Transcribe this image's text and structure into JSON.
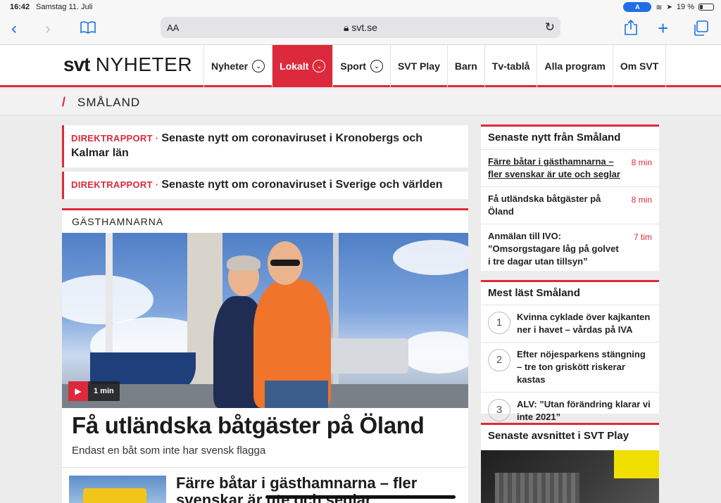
{
  "status_bar": {
    "time": "16:42",
    "date": "Samstag 11. Juli",
    "pill": "A",
    "battery": "19 %"
  },
  "browser": {
    "text_size": "AA",
    "domain": "svt.se"
  },
  "header": {
    "logo_bold": "svt",
    "logo_rest": "NYHETER",
    "nav": [
      {
        "label": "Nyheter",
        "dropdown": true
      },
      {
        "label": "Lokalt",
        "dropdown": true,
        "active": true
      },
      {
        "label": "Sport",
        "dropdown": true
      },
      {
        "label": "SVT Play"
      },
      {
        "label": "Barn"
      },
      {
        "label": "Tv-tablå"
      },
      {
        "label": "Alla program"
      },
      {
        "label": "Om SVT"
      }
    ]
  },
  "region": {
    "name": "SMÅLAND"
  },
  "direktrapport": [
    {
      "tag": "DIREKTRAPPORT",
      "sep": " · ",
      "text": "Senaste nytt om coronaviruset i Kronobergs och Kalmar län"
    },
    {
      "tag": "DIREKTRAPPORT",
      "sep": " · ",
      "text": "Senaste nytt om coronaviruset i Sverige och världen"
    }
  ],
  "feature": {
    "kicker": "GÄSTHAMNARNA",
    "video_duration": "1 min",
    "headline": "Få utländska båtgäster på Öland",
    "lead": "Endast en båt som inte har svensk flagga",
    "sub_headline": "Färre båtar i gästhamnarna – fler svenskar är ute och seglar"
  },
  "sidebar": {
    "latest": {
      "title": "Senaste nytt från Småland",
      "items": [
        {
          "text": "Färre båtar i gästhamnarna – fler svenskar är ute och seglar",
          "ago": "8 min"
        },
        {
          "text": "Få utländska båtgäster på Öland",
          "ago": "8 min"
        },
        {
          "text": "Anmälan till IVO: ”Omsorgstagare låg på golvet i tre dagar utan tillsyn”",
          "ago": "7 tim"
        }
      ]
    },
    "most_read": {
      "title": "Mest läst Småland",
      "items": [
        {
          "num": "1",
          "text": "Kvinna cyklade över kajkanten ner i havet – vårdas på IVA"
        },
        {
          "num": "2",
          "text": "Efter nöjesparkens stängning – tre ton griskött riskerar kastas"
        },
        {
          "num": "3",
          "text": "ALV: ”Utan förändring klarar vi inte 2021”"
        }
      ]
    },
    "svt_play": {
      "title": "Senaste avsnittet i SVT Play"
    }
  },
  "colors": {
    "accent": "#dc2a3c",
    "link_blue": "#1a73e8"
  }
}
